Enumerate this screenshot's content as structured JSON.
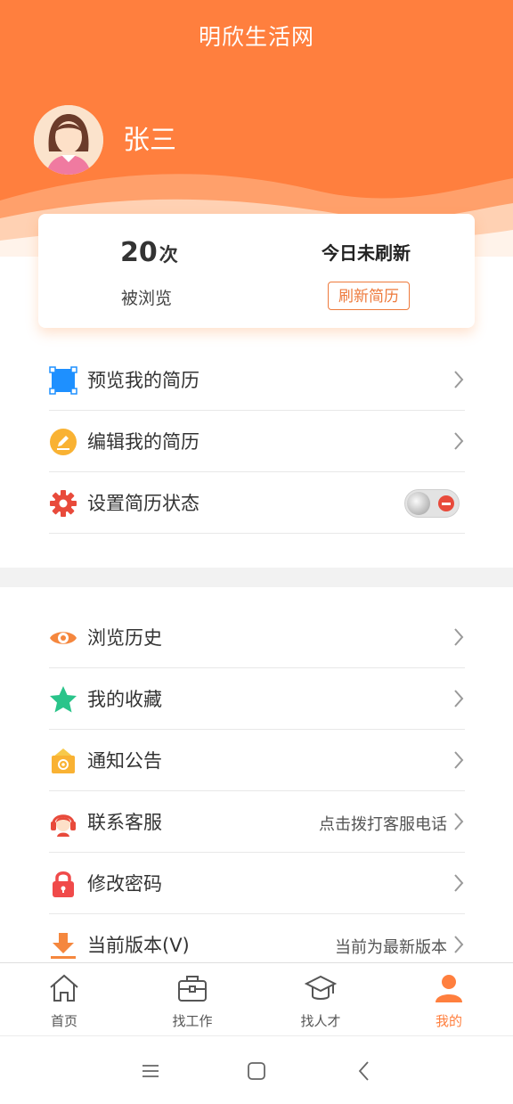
{
  "header": {
    "app_title": "明欣生活网",
    "user_name": "张三"
  },
  "stats": {
    "view_count": "20",
    "view_unit": "次",
    "view_label": "被浏览",
    "refresh_status": "今日未刷新",
    "refresh_button": "刷新简历"
  },
  "resume_menu": [
    {
      "label": "预览我的简历",
      "icon": "preview-icon"
    },
    {
      "label": "编辑我的简历",
      "icon": "edit-icon"
    },
    {
      "label": "设置简历状态",
      "icon": "gear-icon",
      "toggle_on": false
    }
  ],
  "general_menu": [
    {
      "label": "浏览历史",
      "icon": "eye-icon"
    },
    {
      "label": "我的收藏",
      "icon": "star-icon"
    },
    {
      "label": "通知公告",
      "icon": "notice-icon"
    },
    {
      "label": "联系客服",
      "icon": "headset-icon",
      "extra": "点击拨打客服电话"
    },
    {
      "label": "修改密码",
      "icon": "lock-icon"
    },
    {
      "label": "当前版本(V)",
      "icon": "download-icon",
      "extra": "当前为最新版本"
    }
  ],
  "tabs": [
    {
      "label": "首页",
      "icon": "home-icon"
    },
    {
      "label": "找工作",
      "icon": "briefcase-icon"
    },
    {
      "label": "找人才",
      "icon": "graduation-cap-icon"
    },
    {
      "label": "我的",
      "icon": "person-icon",
      "active": true
    }
  ],
  "colors": {
    "brand": "#ff7f3e",
    "accent": "#ee7a3c"
  }
}
